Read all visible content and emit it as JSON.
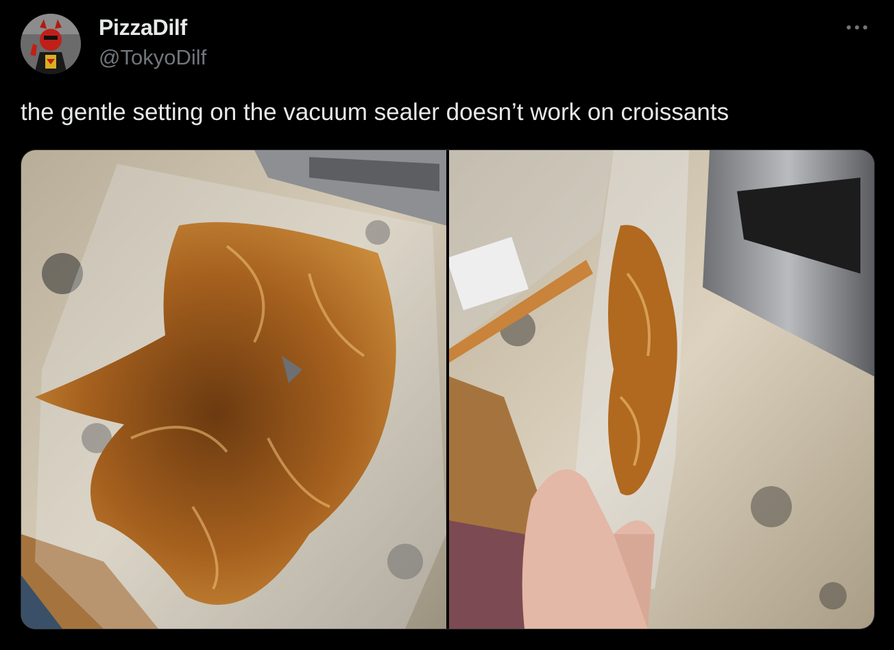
{
  "tweet": {
    "author_name": "PizzaDilf",
    "author_handle": "@TokyoDilf",
    "text": "the gentle setting on the vacuum sealer doesn’t work on croissants"
  },
  "icons": {
    "more": "more-horizontal-icon"
  },
  "media": {
    "count": 2
  },
  "colors": {
    "background": "#000000",
    "primary_text": "#e7e9ea",
    "secondary_text": "#71767b",
    "border": "#2f3336"
  }
}
